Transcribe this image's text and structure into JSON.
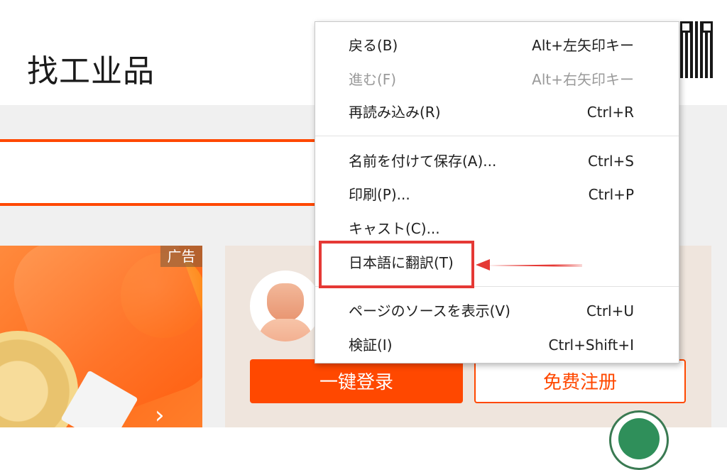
{
  "site": {
    "title": "找工业品"
  },
  "ad": {
    "label": "广告",
    "next_arrow": "›"
  },
  "login": {
    "login_button": "一键登录",
    "register_button": "免费注册"
  },
  "context_menu": {
    "items": [
      {
        "label": "戻る(B)",
        "shortcut": "Alt+左矢印キー",
        "enabled": true
      },
      {
        "label": "進む(F)",
        "shortcut": "Alt+右矢印キー",
        "enabled": false
      },
      {
        "label": "再読み込み(R)",
        "shortcut": "Ctrl+R",
        "enabled": true
      },
      {
        "label": "名前を付けて保存(A)...",
        "shortcut": "Ctrl+S",
        "enabled": true
      },
      {
        "label": "印刷(P)...",
        "shortcut": "Ctrl+P",
        "enabled": true
      },
      {
        "label": "キャスト(C)...",
        "shortcut": "",
        "enabled": true
      },
      {
        "label": "日本語に翻訳(T)",
        "shortcut": "",
        "enabled": true
      },
      {
        "label": "ページのソースを表示(V)",
        "shortcut": "Ctrl+U",
        "enabled": true
      },
      {
        "label": "検証(I)",
        "shortcut": "Ctrl+Shift+I",
        "enabled": true
      }
    ]
  },
  "annotation": {
    "highlight_color": "#e53935"
  },
  "colors": {
    "accent": "#ff4800"
  }
}
